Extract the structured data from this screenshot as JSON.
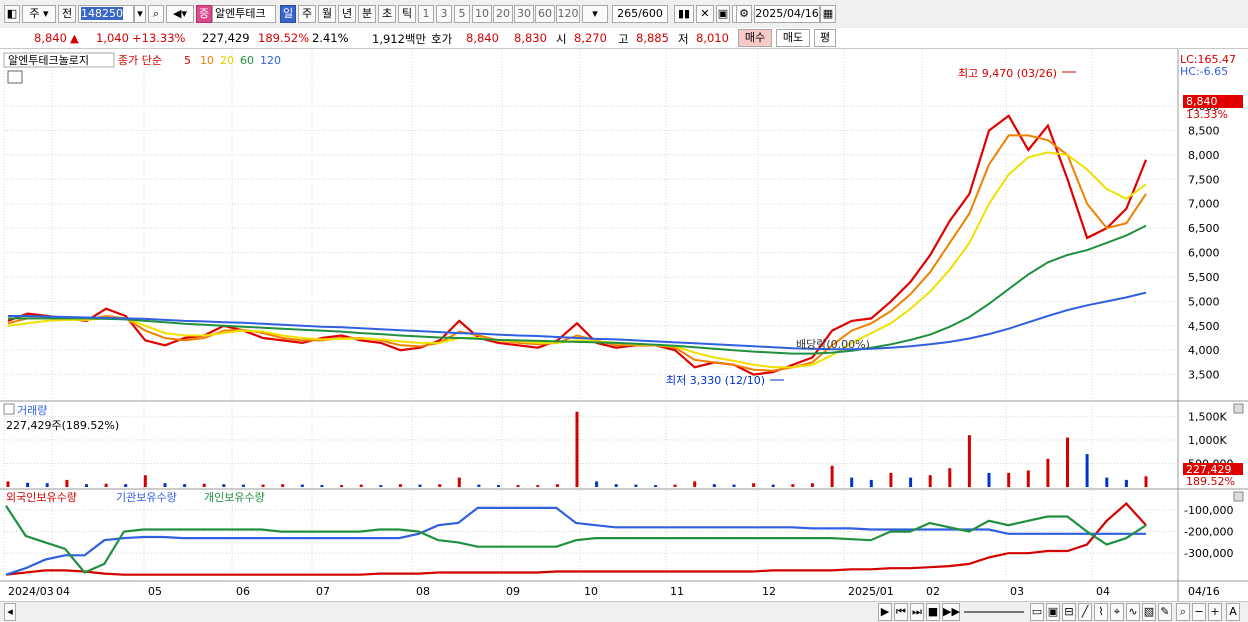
{
  "toolbar": {
    "period_label": "주",
    "compare_label": "전",
    "code": "148250",
    "stock_badge": "증",
    "stock_name": "알엔투테크",
    "timeframes": [
      "일",
      "주",
      "월",
      "년",
      "분",
      "초",
      "틱"
    ],
    "intervals": [
      "1",
      "3",
      "5",
      "10",
      "20",
      "30",
      "60",
      "120"
    ],
    "count": "265/600",
    "date": "2025/04/16"
  },
  "quote": {
    "price": "8,840",
    "arrow": "▲",
    "change": "1,040",
    "change_pct": "+13.33%",
    "volume": "227,429",
    "volume_ratio": "189.52%",
    "turnover": "2.41%",
    "amount": "1,912백만",
    "hoga_label": "호가",
    "ask": "8,840",
    "bid": "8,830",
    "open_label": "시",
    "open": "8,270",
    "high_label": "고",
    "high": "8,885",
    "low_label": "저",
    "low": "8,010",
    "buy_label": "매수",
    "sell_label": "매도",
    "avg_label": "평"
  },
  "colors": {
    "up": "#d40000",
    "down": "#0033cc",
    "ma5": "#e00000",
    "ma10": "#f08000",
    "ma20": "#f0e000",
    "ma60": "#209040",
    "ma120": "#3060e0"
  },
  "chart_data": [
    {
      "type": "line",
      "title": "알엔투테크놀로지",
      "legend": {
        "price_type": "종가 단순",
        "periods": [
          "5",
          "10",
          "20",
          "60",
          "120"
        ]
      },
      "lc": "LC:165.47",
      "hc": "HC:-6.65",
      "ylim": [
        3000,
        9800
      ],
      "yticks": [
        "9,000",
        "8,500",
        "8,000",
        "7,500",
        "7,000",
        "6,500",
        "6,000",
        "5,500",
        "5,000",
        "4,500",
        "4,000",
        "3,500"
      ],
      "last_price": "8,840",
      "last_change": "13.33%",
      "annotations": {
        "high": "최고 9,470 (03/26)",
        "low": "최저 3,330 (12/10)",
        "dividend": "배당락(0.00%)"
      },
      "x_labels": [
        "2024/03",
        "04",
        "05",
        "06",
        "07",
        "08",
        "09",
        "10",
        "11",
        "12",
        "2025/01",
        "02",
        "03",
        "04",
        "04/16"
      ],
      "series": [
        {
          "name": "5",
          "color": "#e00000",
          "values": [
            4600,
            4750,
            4700,
            4650,
            4600,
            4850,
            4700,
            4200,
            4100,
            4250,
            4300,
            4500,
            4400,
            4250,
            4200,
            4150,
            4250,
            4300,
            4200,
            4150,
            4000,
            4050,
            4200,
            4600,
            4250,
            4150,
            4100,
            4050,
            4200,
            4550,
            4150,
            4050,
            4100,
            4100,
            4000,
            3650,
            3750,
            3700,
            3500,
            3550,
            3700,
            3850,
            4400,
            4600,
            4650,
            5000,
            5400,
            5950,
            6650,
            7200,
            8500,
            8800,
            8100,
            8600,
            7500,
            6300,
            6500,
            6900,
            7900
          ]
        },
        {
          "name": "10",
          "color": "#f08000",
          "values": [
            4550,
            4650,
            4650,
            4650,
            4620,
            4700,
            4650,
            4400,
            4250,
            4200,
            4250,
            4400,
            4420,
            4350,
            4250,
            4200,
            4200,
            4250,
            4250,
            4200,
            4100,
            4080,
            4150,
            4380,
            4300,
            4200,
            4150,
            4120,
            4150,
            4300,
            4200,
            4100,
            4100,
            4100,
            4050,
            3800,
            3750,
            3700,
            3600,
            3580,
            3650,
            3750,
            4100,
            4400,
            4550,
            4800,
            5150,
            5600,
            6200,
            6800,
            7800,
            8400,
            8400,
            8300,
            8000,
            7000,
            6500,
            6600,
            7200
          ]
        },
        {
          "name": "20",
          "color": "#f0e000",
          "values": [
            4500,
            4550,
            4600,
            4620,
            4620,
            4650,
            4650,
            4500,
            4350,
            4300,
            4300,
            4350,
            4400,
            4380,
            4300,
            4250,
            4220,
            4230,
            4240,
            4220,
            4180,
            4150,
            4150,
            4250,
            4250,
            4200,
            4180,
            4150,
            4150,
            4200,
            4180,
            4150,
            4120,
            4100,
            4080,
            3950,
            3850,
            3780,
            3700,
            3650,
            3650,
            3700,
            3900,
            4150,
            4350,
            4550,
            4850,
            5200,
            5650,
            6200,
            7000,
            7600,
            7950,
            8050,
            8000,
            7700,
            7300,
            7100,
            7400
          ]
        },
        {
          "name": "60",
          "color": "#209040",
          "values": [
            4650,
            4650,
            4650,
            4650,
            4650,
            4640,
            4630,
            4600,
            4570,
            4540,
            4520,
            4500,
            4480,
            4460,
            4440,
            4420,
            4400,
            4380,
            4350,
            4330,
            4300,
            4280,
            4260,
            4250,
            4230,
            4210,
            4200,
            4190,
            4180,
            4170,
            4160,
            4150,
            4130,
            4110,
            4090,
            4060,
            4030,
            4000,
            3970,
            3950,
            3930,
            3930,
            3950,
            3990,
            4050,
            4120,
            4210,
            4320,
            4480,
            4680,
            4950,
            5250,
            5550,
            5800,
            5950,
            6050,
            6200,
            6350,
            6550
          ]
        },
        {
          "name": "120",
          "color": "#3060e0",
          "values": [
            4700,
            4700,
            4690,
            4680,
            4670,
            4660,
            4650,
            4640,
            4620,
            4600,
            4590,
            4570,
            4560,
            4540,
            4520,
            4500,
            4480,
            4470,
            4450,
            4430,
            4410,
            4390,
            4370,
            4350,
            4340,
            4320,
            4300,
            4290,
            4270,
            4250,
            4230,
            4220,
            4200,
            4180,
            4160,
            4140,
            4120,
            4100,
            4080,
            4060,
            4040,
            4030,
            4020,
            4020,
            4030,
            4050,
            4080,
            4120,
            4170,
            4240,
            4330,
            4440,
            4570,
            4700,
            4820,
            4920,
            5000,
            5080,
            5180
          ]
        }
      ]
    },
    {
      "type": "bar",
      "title": "거래량",
      "subtitle": "227,429주(189.52%)",
      "yticks": [
        "1,500K",
        "1,000K",
        "500,000"
      ],
      "last_value": "227,429",
      "last_ratio": "189.52%",
      "ylim": [
        0,
        1700000
      ],
      "values": [
        120000,
        90000,
        80000,
        150000,
        60000,
        70000,
        60000,
        250000,
        80000,
        60000,
        70000,
        60000,
        50000,
        50000,
        60000,
        50000,
        40000,
        40000,
        50000,
        40000,
        60000,
        50000,
        60000,
        200000,
        50000,
        40000,
        40000,
        40000,
        60000,
        1600000,
        120000,
        60000,
        50000,
        40000,
        50000,
        120000,
        60000,
        50000,
        80000,
        50000,
        60000,
        80000,
        450000,
        200000,
        150000,
        300000,
        200000,
        250000,
        400000,
        1100000,
        300000,
        300000,
        350000,
        600000,
        1050000,
        700000,
        200000,
        150000,
        227429
      ]
    },
    {
      "type": "line",
      "legend": [
        "외국인보유수량",
        "기관보유수량",
        "개인보유수량"
      ],
      "yticks": [
        "-100,000",
        "-200,000",
        "-300,000"
      ],
      "ylim": [
        -420000,
        -30000
      ],
      "series": [
        {
          "name": "외국인보유수량",
          "color": "#d40000",
          "values": [
            -400000,
            -390000,
            -380000,
            -380000,
            -385000,
            -395000,
            -400000,
            -400000,
            -400000,
            -400000,
            -400000,
            -400000,
            -400000,
            -400000,
            -400000,
            -400000,
            -400000,
            -400000,
            -400000,
            -395000,
            -395000,
            -395000,
            -390000,
            -390000,
            -390000,
            -390000,
            -390000,
            -390000,
            -385000,
            -385000,
            -385000,
            -385000,
            -385000,
            -385000,
            -385000,
            -385000,
            -385000,
            -385000,
            -385000,
            -380000,
            -380000,
            -380000,
            -380000,
            -375000,
            -375000,
            -370000,
            -370000,
            -365000,
            -360000,
            -350000,
            -320000,
            -300000,
            -300000,
            -290000,
            -290000,
            -260000,
            -150000,
            -70000,
            -170000
          ]
        },
        {
          "name": "기관보유수량",
          "color": "#3060e0",
          "values": [
            -400000,
            -370000,
            -330000,
            -310000,
            -310000,
            -240000,
            -230000,
            -225000,
            -225000,
            -230000,
            -230000,
            -230000,
            -230000,
            -230000,
            -230000,
            -230000,
            -230000,
            -230000,
            -230000,
            -230000,
            -230000,
            -210000,
            -170000,
            -160000,
            -90000,
            -90000,
            -90000,
            -90000,
            -90000,
            -160000,
            -170000,
            -180000,
            -180000,
            -180000,
            -180000,
            -180000,
            -180000,
            -180000,
            -180000,
            -180000,
            -180000,
            -185000,
            -185000,
            -185000,
            -190000,
            -190000,
            -190000,
            -190000,
            -190000,
            -190000,
            -190000,
            -210000,
            -210000,
            -210000,
            -210000,
            -210000,
            -210000,
            -210000,
            -210000
          ]
        },
        {
          "name": "개인보유수량",
          "color": "#209040",
          "values": [
            -80000,
            -220000,
            -250000,
            -280000,
            -390000,
            -350000,
            -200000,
            -190000,
            -190000,
            -190000,
            -190000,
            -190000,
            -190000,
            -190000,
            -200000,
            -200000,
            -200000,
            -200000,
            -200000,
            -190000,
            -190000,
            -200000,
            -240000,
            -250000,
            -270000,
            -270000,
            -270000,
            -270000,
            -270000,
            -240000,
            -230000,
            -230000,
            -230000,
            -230000,
            -230000,
            -230000,
            -230000,
            -230000,
            -230000,
            -230000,
            -230000,
            -230000,
            -230000,
            -235000,
            -240000,
            -200000,
            -200000,
            -160000,
            -180000,
            -200000,
            -150000,
            -170000,
            -150000,
            -130000,
            -130000,
            -200000,
            -260000,
            -230000,
            -170000
          ]
        }
      ]
    }
  ],
  "footer": {
    "controls": [
      "▶",
      "⏮",
      "⏭",
      "■",
      "▶▶"
    ]
  }
}
